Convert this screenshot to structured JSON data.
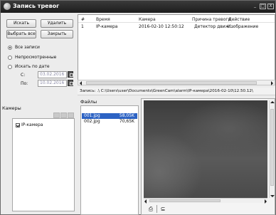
{
  "window": {
    "title": "Запись тревог",
    "controls": {
      "minimize": "_",
      "maximize": "□",
      "close": "X"
    }
  },
  "toolbar": {
    "search_label": "Искать",
    "delete_label": "Удалить",
    "select_all_label": "Выбрать все",
    "close_label": "Закрыть"
  },
  "filters": {
    "options": [
      "Все записи",
      "Непросмотренные",
      "Искать по дате"
    ],
    "selected": "Все записи",
    "from_label": "С:",
    "from_value": "03.02.2016",
    "to_label": "По:",
    "to_value": "10.02.2016"
  },
  "cameras": {
    "label": "Камеры",
    "items": [
      {
        "name": "IP-камера",
        "checked": true
      }
    ]
  },
  "events": {
    "columns": [
      "#",
      "Время",
      "Камера",
      "Причина тревоги",
      "Действие"
    ],
    "rows": [
      [
        "1",
        "2016-02-10 12:50:12",
        "IP-камера",
        "Детектор движ...",
        "Изображение"
      ]
    ]
  },
  "record_path": {
    "label": "Запись: .\\",
    "value": "C:\\Users\\user\\Documents\\GreenCam\\alarm\\IP-камера\\2016-02-10\\12.50.12\\"
  },
  "files": {
    "label": "Файлы",
    "items": [
      {
        "name": "001.jpg",
        "size": "58,05K",
        "selected": true
      },
      {
        "name": "002.jpg",
        "size": "70,65K",
        "selected": false
      }
    ]
  },
  "preview": {
    "tools": {
      "print_icon": "⎙",
      "save_icon": "⊆"
    }
  },
  "colors": {
    "titlebar": "#1d1d1d",
    "selection": "#2d63c4",
    "panel": "#ececec"
  }
}
